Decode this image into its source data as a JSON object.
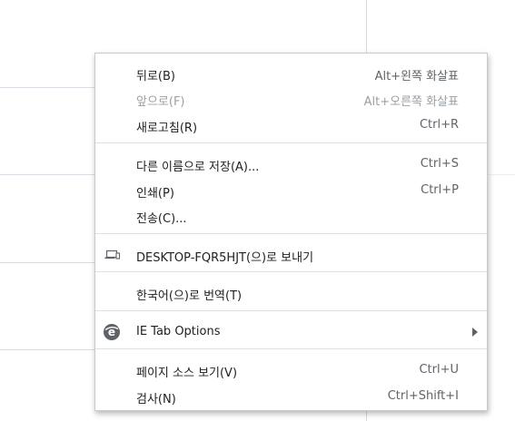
{
  "menu": {
    "items": [
      {
        "label": "뒤로(B)",
        "shortcut": "Alt+왼쪽 화살표",
        "disabled": false
      },
      {
        "label": "앞으로(F)",
        "shortcut": "Alt+오른쪽 화살표",
        "disabled": true
      },
      {
        "label": "새로고침(R)",
        "shortcut": "Ctrl+R",
        "disabled": false
      },
      {
        "label": "다른 이름으로 저장(A)...",
        "shortcut": "Ctrl+S",
        "disabled": false
      },
      {
        "label": "인쇄(P)",
        "shortcut": "Ctrl+P",
        "disabled": false
      },
      {
        "label": "전송(C)...",
        "shortcut": "",
        "disabled": false
      },
      {
        "label": "DESKTOP-FQR5HJT(으)로 보내기",
        "shortcut": "",
        "icon": "devices-icon",
        "disabled": false
      },
      {
        "label": "한국어(으)로 번역(T)",
        "shortcut": "",
        "disabled": false
      },
      {
        "label": "IE Tab Options",
        "shortcut": "",
        "icon": "ie-tab-extension-icon",
        "submenu": true,
        "disabled": false
      },
      {
        "label": "페이지 소스 보기(V)",
        "shortcut": "Ctrl+U",
        "disabled": false
      },
      {
        "label": "검사(N)",
        "shortcut": "Ctrl+Shift+I",
        "disabled": false
      }
    ],
    "colors": {
      "text": "#202124",
      "disabled_text": "#9aa0a6",
      "separator": "#e0e0e0",
      "ie_icon": "#5f6368"
    }
  }
}
